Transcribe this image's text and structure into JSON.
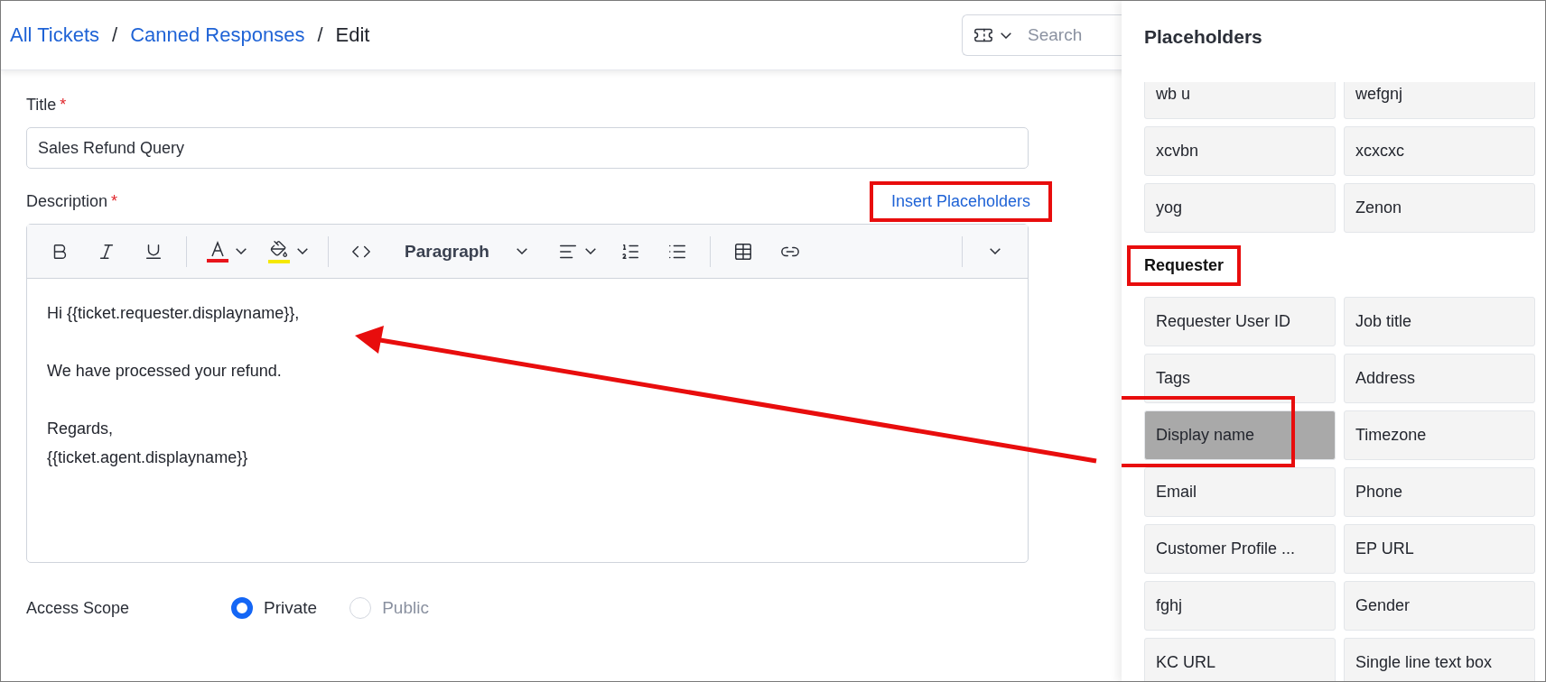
{
  "breadcrumb": [
    {
      "label": "All Tickets",
      "link": true
    },
    {
      "label": "Canned Responses",
      "link": true
    },
    {
      "label": "Edit",
      "link": false
    }
  ],
  "breadcrumb_separator": "/",
  "search": {
    "placeholder": "Search"
  },
  "form": {
    "title_label": "Title",
    "title_required_mark": "*",
    "title_value": "Sales Refund Query",
    "description_label": "Description",
    "description_required_mark": "*",
    "insert_link": {
      "label": "Insert Placeholders",
      "highlighted": true
    },
    "toolbar": {
      "font_color": {
        "color": "#e8141b"
      },
      "highlight_color": {
        "color": "#f5e800"
      },
      "block_style": "Paragraph"
    },
    "body": [
      [
        "Hi {{ticket.requester.displayname}},"
      ],
      [
        "We have processed your refund."
      ],
      [
        "Regards,",
        "{{ticket.agent.displayname}}"
      ]
    ],
    "access_label": "Access Scope",
    "access_options": [
      {
        "label": "Private",
        "selected": true,
        "disabled": false
      },
      {
        "label": "Public",
        "selected": false,
        "disabled": true
      }
    ]
  },
  "panel": {
    "title": "Placeholders",
    "sections": [
      {
        "items": [
          {
            "label": "wb u",
            "selected": false
          },
          {
            "label": "wefgnj",
            "selected": false
          },
          {
            "label": "xcvbn",
            "selected": false
          },
          {
            "label": "xcxcxc",
            "selected": false
          },
          {
            "label": "yog",
            "selected": false
          },
          {
            "label": "Zenon",
            "selected": false
          }
        ]
      },
      {
        "heading": "Requester",
        "highlighted": true,
        "items": [
          {
            "label": "Requester User ID",
            "selected": false
          },
          {
            "label": "Job title",
            "selected": false
          },
          {
            "label": "Tags",
            "selected": false
          },
          {
            "label": "Address",
            "selected": false
          },
          {
            "label": "Display name",
            "selected": true,
            "highlighted": true
          },
          {
            "label": "Timezone",
            "selected": false
          },
          {
            "label": "Email",
            "selected": false
          },
          {
            "label": "Phone",
            "selected": false
          },
          {
            "label": "Customer Profile ...",
            "selected": false
          },
          {
            "label": "EP URL",
            "selected": false
          },
          {
            "label": "fghj",
            "selected": false
          },
          {
            "label": "Gender",
            "selected": false
          },
          {
            "label": "KC URL",
            "selected": false
          },
          {
            "label": "Single line text box",
            "selected": false
          }
        ]
      }
    ]
  },
  "annotation_arrow": true
}
